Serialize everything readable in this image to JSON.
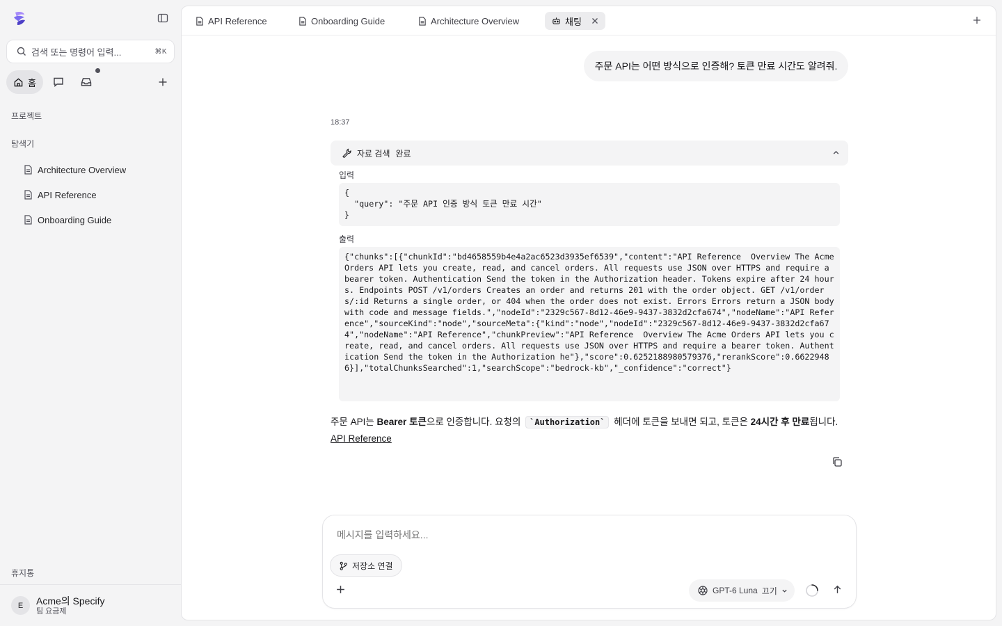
{
  "sidebar": {
    "search": {
      "placeholder": "검색 또는 명령어 입력...",
      "shortcut": "⌘K"
    },
    "nav": {
      "home_label": "홈"
    },
    "projects_label": "프로젝트",
    "explorer_label": "탐색기",
    "tree_items": [
      {
        "label": "Architecture Overview"
      },
      {
        "label": "API Reference"
      },
      {
        "label": "Onboarding Guide"
      }
    ],
    "trash_label": "휴지통",
    "account": {
      "initial": "E",
      "name": "Acme의 Specify",
      "plan": "팀 요금제"
    }
  },
  "tabs": [
    {
      "label": "API Reference"
    },
    {
      "label": "Onboarding Guide"
    },
    {
      "label": "Architecture Overview"
    },
    {
      "label": "채팅"
    }
  ],
  "chat": {
    "user_message": "주문 API는 어떤 방식으로 인증해? 토큰 만료 시간도 알려줘.",
    "timestamp": "18:37",
    "tool": {
      "name": "자료 검색",
      "status": "완료",
      "input_label": "입력",
      "input_json": "{\n  \"query\": \"주문 API 인증 방식 토큰 만료 시간\"\n}",
      "output_label": "출력",
      "output_json": "{\"chunks\":[{\"chunkId\":\"bd4658559b4e4a2ac6523d3935ef6539\",\"content\":\"API Reference  Overview The Acme Orders API lets you create, read, and cancel orders. All requests use JSON over HTTPS and require a bearer token. Authentication Send the token in the Authorization header. Tokens expire after 24 hours. Endpoints POST /v1/orders Creates an order and returns 201 with the order object. GET /v1/orders/:id Returns a single order, or 404 when the order does not exist. Errors Errors return a JSON body with code and message fields.\",\"nodeId\":\"2329c567-8d12-46e9-9437-3832d2cfa674\",\"nodeName\":\"API Reference\",\"sourceKind\":\"node\",\"sourceMeta\":{\"kind\":\"node\",\"nodeId\":\"2329c567-8d12-46e9-9437-3832d2cfa674\",\"nodeName\":\"API Reference\",\"chunkPreview\":\"API Reference  Overview The Acme Orders API lets you create, read, and cancel orders. All requests use JSON over HTTPS and require a bearer token. Authentication Send the token in the Authorization he\"},\"score\":0.6252188980579376,\"rerankScore\":0.66229486}],\"totalChunksSearched\":1,\"searchScope\":\"bedrock-kb\",\"_confidence\":\"correct\"}"
    },
    "answer": {
      "part1": "주문 API는 ",
      "bold1": "Bearer 토큰",
      "part2": "으로 인증합니다. 요청의 ",
      "code": "`Authorization`",
      "part3": " 헤더에 토큰을 보내면 되고, 토큰은 ",
      "bold2": "24시간 후 만료",
      "part4": "됩니다.",
      "link": "API Reference"
    }
  },
  "composer": {
    "placeholder": "메시지를 입력하세요...",
    "repo_button": "저장소 연결",
    "model_name": "GPT-6 Luna",
    "model_mode": "끄기"
  },
  "colors": {
    "accent": "#7c6cf0",
    "panel": "#ffffff",
    "sidebar": "#f4f4f5"
  }
}
